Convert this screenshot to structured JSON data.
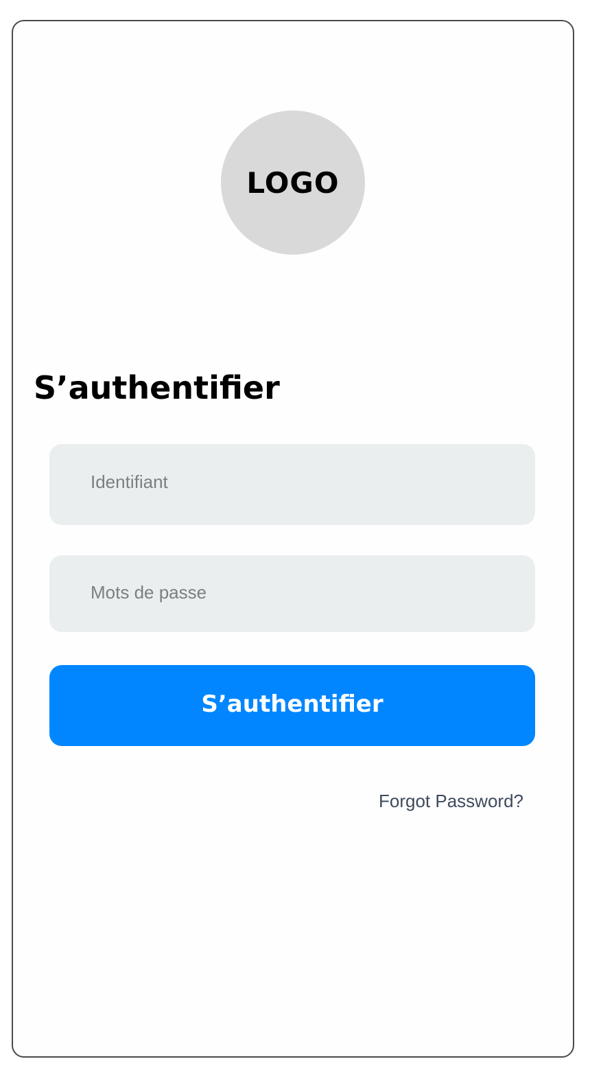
{
  "logo": {
    "text": "LOGO"
  },
  "title": "S’authentifier",
  "form": {
    "username_placeholder": "Identifiant",
    "password_placeholder": "Mots de passe",
    "submit_label": "S’authentifier",
    "forgot_password_label": "Forgot Password?"
  },
  "colors": {
    "accent": "#0186ff",
    "field_background": "#ebeeef",
    "logo_background": "#d9d9d9",
    "link_text": "#3d4b5c"
  }
}
